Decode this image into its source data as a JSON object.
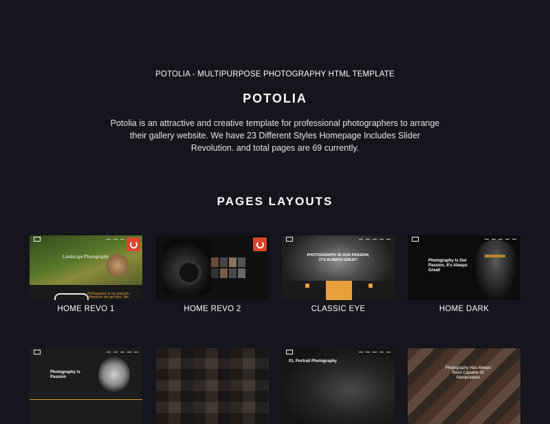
{
  "header": {
    "subtitle": "POTOLIA - MULTIPURPOSE PHOTOGRAPHY HTML TEMPLATE",
    "title": "POTOLIA",
    "description": "Potolia is an attractive and creative template for professional photographers to arrange their gallery website. We have 23 Different Styles Homepage Includes Slider Revolution. and total pages are 69 currently."
  },
  "layouts": {
    "section_title": "PAGES LAYOUTS",
    "cards": [
      {
        "label": "HOME REVO 1",
        "hero": "Landscape Photography",
        "caption": "Photography is our passion, Whenever we get time, We"
      },
      {
        "label": "HOME REVO 2"
      },
      {
        "label": "CLASSIC EYE",
        "hero": "PHOTOGRAPHY IS OUR PASSION, IT'S ALWAYS GREAT!"
      },
      {
        "label": "HOME DARK",
        "hero": "Photography Is Our Passion, It's Always Great!"
      },
      {
        "label": "",
        "hero": "Photography is Passion"
      },
      {
        "label": ""
      },
      {
        "label": "",
        "hero": "01. Portrait Photography"
      },
      {
        "label": "",
        "hero": "Photography Has Always Been Capable Of Manipulation"
      }
    ]
  },
  "colors": {
    "background": "#15151d",
    "accent": "#d9462c",
    "gold": "#e8a13a"
  }
}
